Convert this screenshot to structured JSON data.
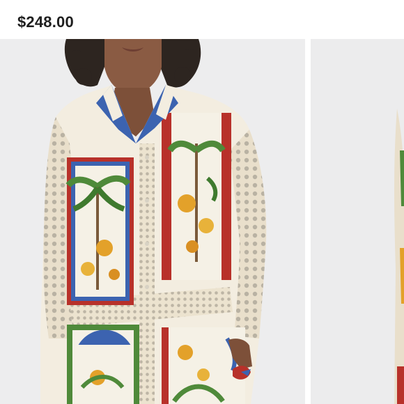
{
  "listing": {
    "price": "$248.00"
  },
  "carousel": {
    "slides": [
      {
        "subject": "model-wearing-tropical-print-crochet-shirt"
      },
      {
        "subject": "partial-next-product-photo"
      }
    ]
  },
  "colors": {
    "page_bg": "#ffffff",
    "photo_bg": "#ededee",
    "price_text": "#1f1f1f",
    "print_cream": "#f3ede0",
    "crochet_cream": "#e9dfcb",
    "print_red": "#b8312a",
    "print_blue": "#3c63b0",
    "leaf_green": "#4f8a3a",
    "flower_orange": "#e3a12a"
  }
}
